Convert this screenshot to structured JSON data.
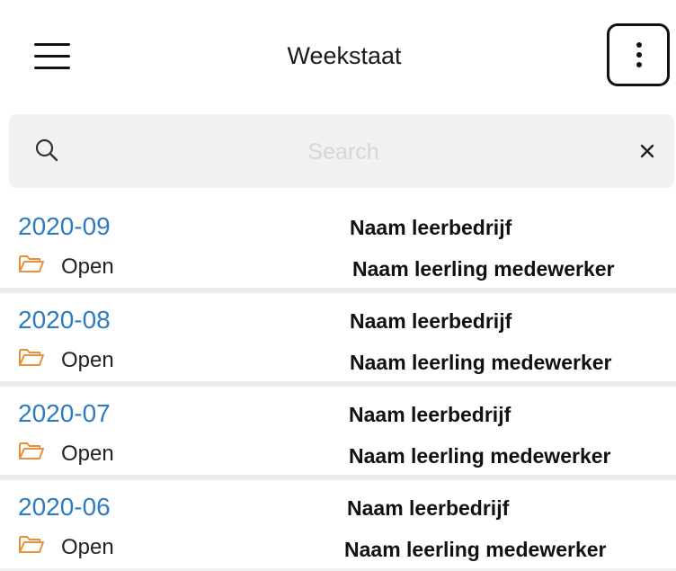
{
  "header": {
    "title": "Weekstaat"
  },
  "search": {
    "placeholder": "Search",
    "value": ""
  },
  "icons": {
    "menu": "hamburger-menu-icon",
    "more": "vertical-ellipsis-icon",
    "search": "magnifier-icon",
    "clear": "close-x-icon",
    "status": "open-folder-icon"
  },
  "colors": {
    "period_link": "#2f7bbf",
    "folder_icon": "#e8913a",
    "search_background": "#f1f1f1"
  },
  "weeks": [
    {
      "period": "2020-09",
      "status": "Open",
      "company": "Naam leerbedrijf",
      "student": "Naam leerling medewerker"
    },
    {
      "period": "2020-08",
      "status": "Open",
      "company": "Naam leerbedrijf",
      "student": "Naam leerling medewerker"
    },
    {
      "period": "2020-07",
      "status": "Open",
      "company": "Naam leerbedrijf",
      "student": "Naam leerling medewerker"
    },
    {
      "period": "2020-06",
      "status": "Open",
      "company": "Naam leerbedrijf",
      "student": "Naam leerling medewerker"
    }
  ]
}
